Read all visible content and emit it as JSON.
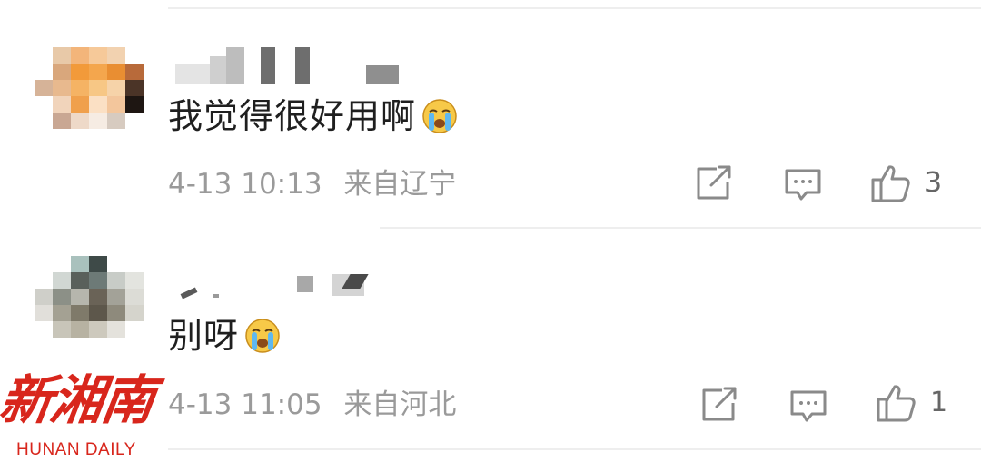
{
  "comments": [
    {
      "text": "我觉得很好用啊",
      "emoji": "loudly-crying-face",
      "date": "4-13",
      "time": "10:13",
      "location": "来自辽宁",
      "like_count": "3"
    },
    {
      "text": "别呀",
      "emoji": "loudly-crying-face",
      "date": "4-13",
      "time": "11:05",
      "location": "来自河北",
      "like_count": "1"
    }
  ],
  "watermark": {
    "cn": "新湘南",
    "en": "HUNAN DAILY"
  },
  "colors": {
    "text": "#1f1f1f",
    "meta": "#9a9a9a",
    "icon": "#8a8a8a",
    "watermark": "#d8261c"
  }
}
